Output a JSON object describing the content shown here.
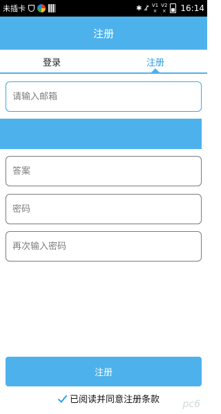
{
  "status_bar": {
    "carrier": "未插卡",
    "signal_1": "V1",
    "signal_2": "V2",
    "time": "16:14"
  },
  "app_bar": {
    "title": "注册"
  },
  "tabs": [
    {
      "label": "登录",
      "active": false
    },
    {
      "label": "注册",
      "active": true
    }
  ],
  "form": {
    "email_placeholder": "请输入邮箱",
    "answer_placeholder": "答案",
    "password_placeholder": "密码",
    "confirm_password_placeholder": "再次输入密码"
  },
  "submit_label": "注册",
  "agreement": {
    "label": "已阅读并同意注册条款",
    "checked": true
  },
  "watermark": "pc6",
  "colors": {
    "accent": "#4db2ec",
    "accent_text": "#2a9ee6"
  }
}
